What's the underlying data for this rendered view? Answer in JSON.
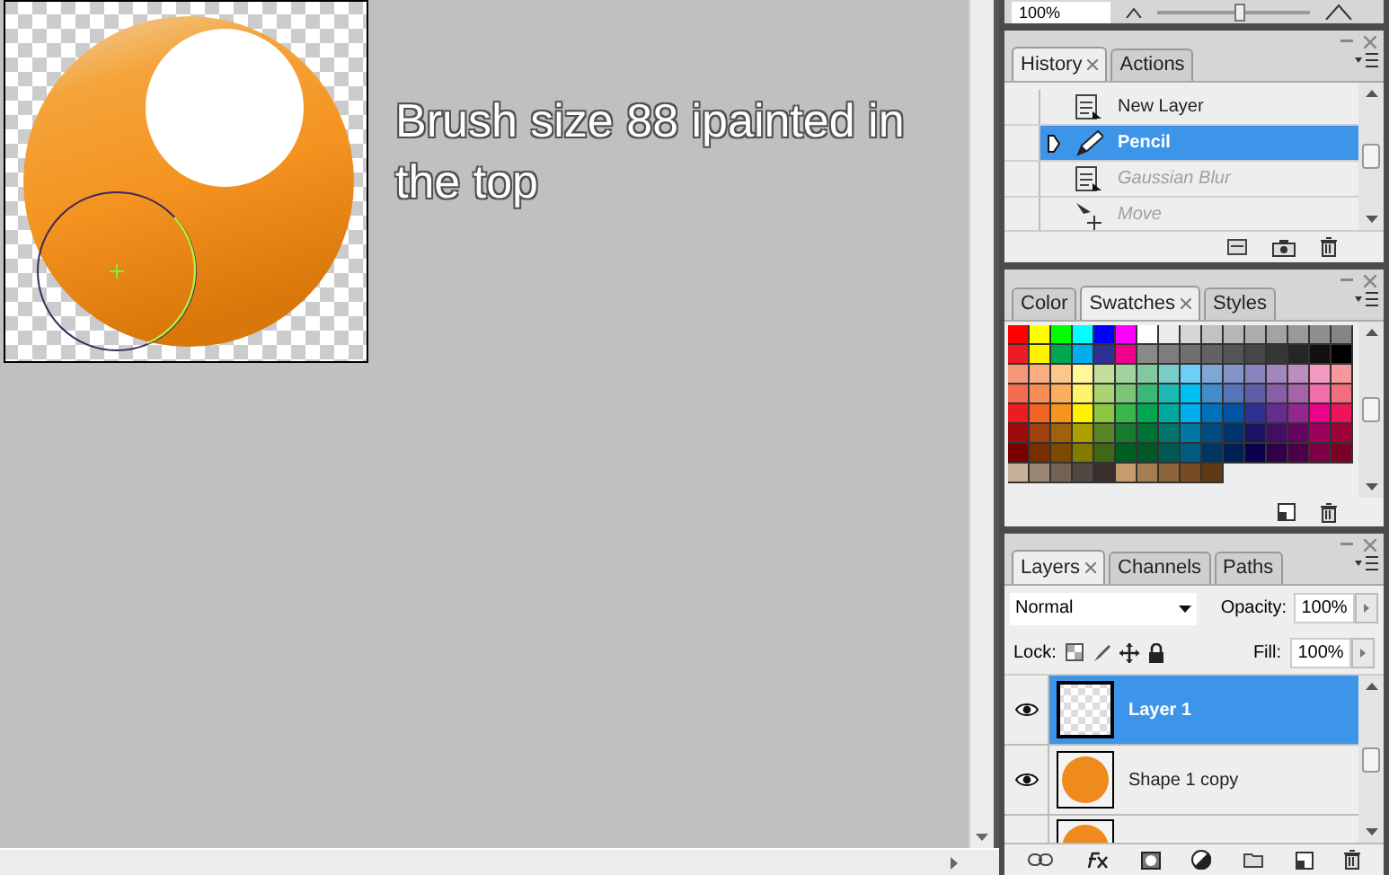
{
  "canvas": {
    "annotation": "Brush size 88 ipainted in the top"
  },
  "navigator": {
    "zoom": "100%",
    "level": 0.5
  },
  "history": {
    "tabs": [
      {
        "label": "History",
        "selected": true,
        "closable": true
      },
      {
        "label": "Actions",
        "selected": false,
        "closable": false
      }
    ],
    "items": [
      {
        "label": "New Layer",
        "kind": "layer",
        "selected": false,
        "undone": false
      },
      {
        "label": "Pencil",
        "kind": "pencil",
        "selected": true,
        "undone": false
      },
      {
        "label": "Gaussian Blur",
        "kind": "layer",
        "selected": false,
        "undone": true
      },
      {
        "label": "Move",
        "kind": "move",
        "selected": false,
        "undone": true
      }
    ]
  },
  "swatches": {
    "tabs": [
      {
        "label": "Color",
        "selected": false,
        "closable": false
      },
      {
        "label": "Swatches",
        "selected": true,
        "closable": true
      },
      {
        "label": "Styles",
        "selected": false,
        "closable": false
      }
    ],
    "rows": [
      [
        {
          "color": "#ff0000"
        },
        {
          "color": "#ffff00"
        },
        {
          "color": "#00ff00"
        },
        {
          "color": "#00ffff"
        },
        {
          "color": "#0000ff"
        },
        {
          "color": "#ff00ff"
        },
        {
          "color": "#ffffff"
        },
        {
          "color": "#ebebeb"
        },
        {
          "color": "#d6d6d6"
        },
        {
          "color": "#c2c2c2"
        },
        {
          "color": "#b7b7b7"
        },
        {
          "color": "#adadad"
        },
        {
          "color": "#a3a3a3"
        },
        {
          "color": "#999999"
        },
        {
          "color": "#8f8f8f"
        },
        {
          "color": "#858585"
        }
      ],
      [
        {
          "color": "#ed1c24"
        },
        {
          "color": "#fff200"
        },
        {
          "color": "#00a651"
        },
        {
          "color": "#00aeef"
        },
        {
          "color": "#2e3192"
        },
        {
          "color": "#ec008c"
        },
        {
          "color": "#898989"
        },
        {
          "color": "#7d7d7d"
        },
        {
          "color": "#6f6f6f"
        },
        {
          "color": "#626262"
        },
        {
          "color": "#555555"
        },
        {
          "color": "#464646"
        },
        {
          "color": "#363636"
        },
        {
          "color": "#262626"
        },
        {
          "color": "#111111"
        },
        {
          "color": "#000000"
        }
      ],
      [
        {
          "color": "#f7977a"
        },
        {
          "color": "#f9ad81"
        },
        {
          "color": "#fdc68a"
        },
        {
          "color": "#fff79a"
        },
        {
          "color": "#c4df9b"
        },
        {
          "color": "#a3d39c"
        },
        {
          "color": "#82ca9d"
        },
        {
          "color": "#7bcdc8"
        },
        {
          "color": "#6ecff6"
        },
        {
          "color": "#7ea7d8"
        },
        {
          "color": "#8493ca"
        },
        {
          "color": "#8882be"
        },
        {
          "color": "#a187be"
        },
        {
          "color": "#bc8dbf"
        },
        {
          "color": "#f49ac2"
        },
        {
          "color": "#f6989d"
        }
      ],
      [
        {
          "color": "#f26c4f"
        },
        {
          "color": "#f68e55"
        },
        {
          "color": "#fbaf5c"
        },
        {
          "color": "#fff467"
        },
        {
          "color": "#acd372"
        },
        {
          "color": "#7cc576"
        },
        {
          "color": "#3bb878"
        },
        {
          "color": "#1abbb4"
        },
        {
          "color": "#00bff3"
        },
        {
          "color": "#438ccb"
        },
        {
          "color": "#5574b9"
        },
        {
          "color": "#605ca8"
        },
        {
          "color": "#855fa8"
        },
        {
          "color": "#a763a8"
        },
        {
          "color": "#f06ea9"
        },
        {
          "color": "#f26d7d"
        }
      ],
      [
        {
          "color": "#ed1c24"
        },
        {
          "color": "#f26522"
        },
        {
          "color": "#f7941d"
        },
        {
          "color": "#fff200"
        },
        {
          "color": "#8dc73f"
        },
        {
          "color": "#39b54a"
        },
        {
          "color": "#00a651"
        },
        {
          "color": "#00a99d"
        },
        {
          "color": "#00aeef"
        },
        {
          "color": "#0072bc"
        },
        {
          "color": "#0054a6"
        },
        {
          "color": "#2e3192"
        },
        {
          "color": "#662d91"
        },
        {
          "color": "#92278f"
        },
        {
          "color": "#ec008c"
        },
        {
          "color": "#ed145b"
        }
      ],
      [
        {
          "color": "#9e0b0f"
        },
        {
          "color": "#a0410d"
        },
        {
          "color": "#a36209"
        },
        {
          "color": "#aba000"
        },
        {
          "color": "#598527"
        },
        {
          "color": "#197b30"
        },
        {
          "color": "#007236"
        },
        {
          "color": "#00746b"
        },
        {
          "color": "#0076a3"
        },
        {
          "color": "#004b80"
        },
        {
          "color": "#003471"
        },
        {
          "color": "#1b1464"
        },
        {
          "color": "#440e62"
        },
        {
          "color": "#630460"
        },
        {
          "color": "#9e005d"
        },
        {
          "color": "#9e0039"
        }
      ],
      [
        {
          "color": "#790000"
        },
        {
          "color": "#7b2e00"
        },
        {
          "color": "#7d4900"
        },
        {
          "color": "#827b00"
        },
        {
          "color": "#406618"
        },
        {
          "color": "#005e20"
        },
        {
          "color": "#005826"
        },
        {
          "color": "#005952"
        },
        {
          "color": "#005b7f"
        },
        {
          "color": "#003663"
        },
        {
          "color": "#002157"
        },
        {
          "color": "#0d004c"
        },
        {
          "color": "#32004b"
        },
        {
          "color": "#4b0049"
        },
        {
          "color": "#7b0046"
        },
        {
          "color": "#7a0026"
        }
      ],
      [
        {
          "color": "#c7b299"
        },
        {
          "color": "#998675"
        },
        {
          "color": "#736357"
        },
        {
          "color": "#534741"
        },
        {
          "color": "#362f2d"
        },
        {
          "color": "#c69c6d"
        },
        {
          "color": "#a67c52"
        },
        {
          "color": "#8c6239"
        },
        {
          "color": "#754c24"
        },
        {
          "color": "#603913"
        }
      ]
    ]
  },
  "layers": {
    "tabs": [
      {
        "label": "Layers",
        "selected": true,
        "closable": true
      },
      {
        "label": "Channels",
        "selected": false,
        "closable": false
      },
      {
        "label": "Paths",
        "selected": false,
        "closable": false
      }
    ],
    "blend_mode": "Normal",
    "opacity_label": "Opacity:",
    "opacity": "100%",
    "lock_label": "Lock:",
    "fill_label": "Fill:",
    "fill": "100%",
    "items": [
      {
        "name": "Layer 1",
        "kind": "empty",
        "selected": true,
        "visible": true
      },
      {
        "name": "Shape 1 copy",
        "kind": "shape",
        "selected": false,
        "visible": true
      },
      {
        "kind": "shape",
        "selected": false
      }
    ]
  }
}
